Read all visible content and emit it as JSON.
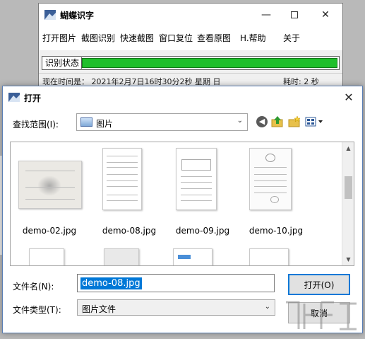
{
  "app": {
    "title": "蝴蝶识字",
    "menu": [
      "打开图片",
      "截图识别",
      "快速截图",
      "窗口复位",
      "查看原图",
      "H.帮助",
      "关于"
    ],
    "status_label": "识别状态",
    "progress_fraction": 1.0,
    "progress_color": "#1fbf2b",
    "current_time": "现在时间是：  2021年2月7日16时30分2秒  星期 日",
    "elapsed": "耗时: 2 秒"
  },
  "dialog": {
    "title": "打开",
    "look_in_label": "查找范围(I):",
    "look_in_value": "图片",
    "toolbar_icons": [
      "back-icon",
      "up-folder-icon",
      "new-folder-icon",
      "view-menu-icon"
    ],
    "files": [
      {
        "name": "demo-02.jpg"
      },
      {
        "name": "demo-08.jpg"
      },
      {
        "name": "demo-09.jpg"
      },
      {
        "name": "demo-10.jpg"
      }
    ],
    "file_name_label": "文件名(N):",
    "file_name_value": "demo-08.jpg",
    "file_type_label": "文件类型(T):",
    "file_type_value": "图片文件",
    "open_button": "打开(O)",
    "cancel_button": "取消"
  }
}
